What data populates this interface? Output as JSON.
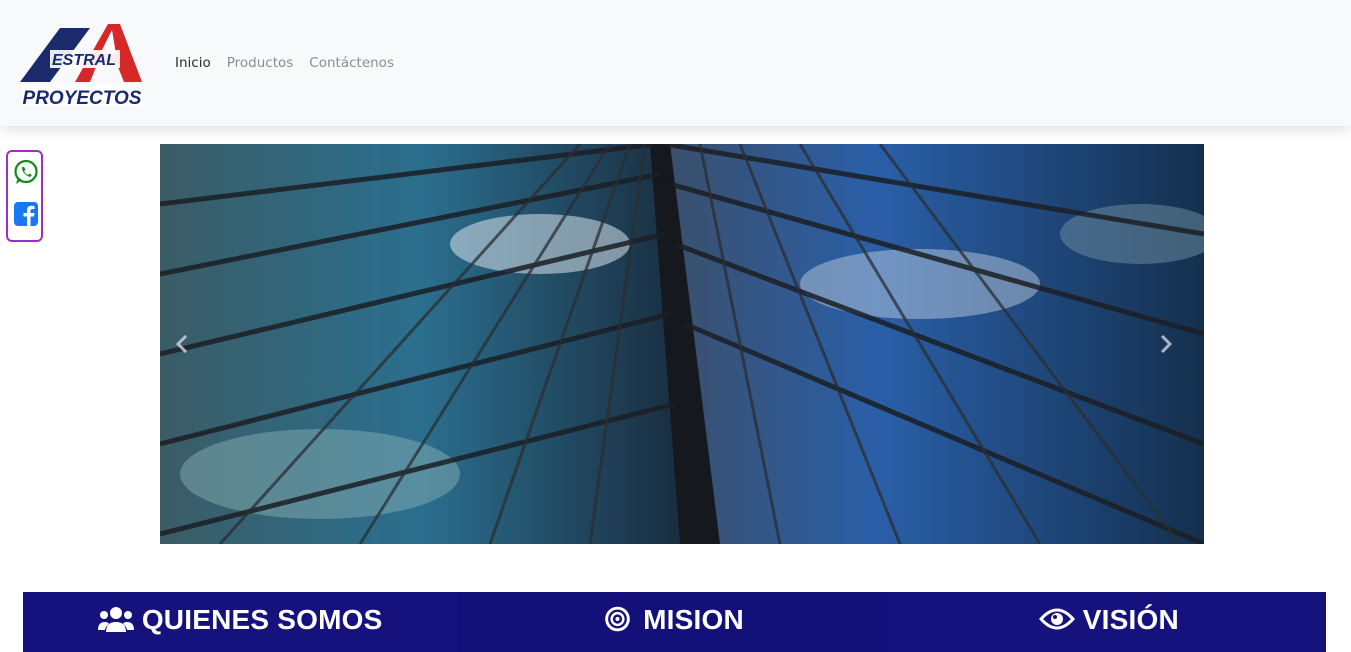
{
  "brand": {
    "logo_top_text": "ESTRAL",
    "logo_bottom_text": "PROYECTOS",
    "colors": {
      "navy": "#1a2a6c",
      "red": "#d62828"
    }
  },
  "nav": {
    "items": [
      {
        "label": "Inicio",
        "active": true
      },
      {
        "label": "Productos",
        "active": false
      },
      {
        "label": "Contáctenos",
        "active": false
      }
    ]
  },
  "social": {
    "items": [
      {
        "icon": "whatsapp-icon",
        "color": "#128c1e"
      },
      {
        "icon": "facebook-icon",
        "color": "#1877f2"
      }
    ],
    "border_color": "#9b2fc6"
  },
  "carousel": {
    "image": "glass-skyscraper-photo",
    "prev_icon": "chevron-left-icon",
    "next_icon": "chevron-right-icon"
  },
  "sections": [
    {
      "icon": "users-icon",
      "title": "QUIENES SOMOS"
    },
    {
      "icon": "target-icon",
      "title": "MISION"
    },
    {
      "icon": "eye-icon",
      "title": "VISIÓN"
    }
  ],
  "theme": {
    "section_bg": "#15127d"
  }
}
